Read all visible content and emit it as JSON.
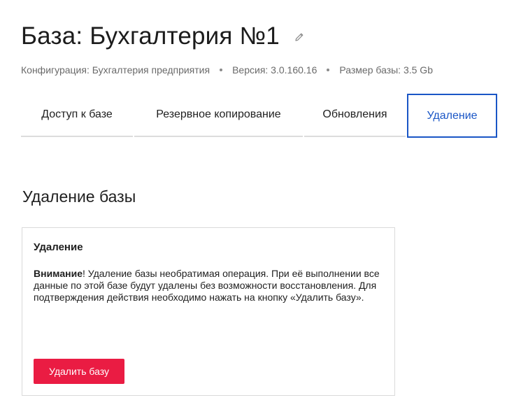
{
  "header": {
    "title": "База: Бухгалтерия №1",
    "edit_icon": "pencil-icon"
  },
  "meta": {
    "configuration": "Конфигурация: Бухгалтерия предприятия",
    "version": "Версия: 3.0.160.16",
    "size": "Размер базы: 3.5 Gb"
  },
  "tabs": [
    {
      "label": "Доступ к базе",
      "active": false
    },
    {
      "label": "Резервное копирование",
      "active": false
    },
    {
      "label": "Обновления",
      "active": false
    },
    {
      "label": "Удаление",
      "active": true
    }
  ],
  "section": {
    "title": "Удаление базы"
  },
  "card": {
    "title": "Удаление",
    "warning_bold": "Внимание",
    "warning_text": "! Удаление базы необратимая операция. При её выполнении все данные по этой базе будут удалены без возможности восстановления. Для подтверждения действия необходимо нажать на кнопку «Удалить базу».",
    "button_label": "Удалить базу"
  },
  "colors": {
    "accent": "#1a56c6",
    "danger": "#ea1c43"
  }
}
